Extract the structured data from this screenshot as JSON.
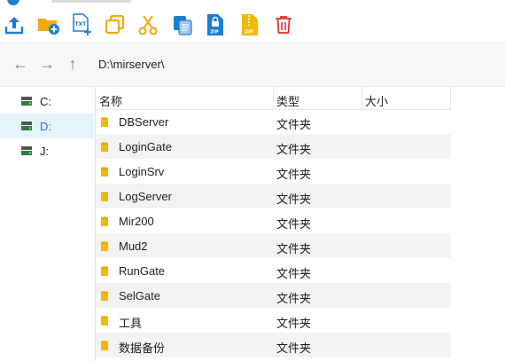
{
  "toolbar": {
    "buttons": [
      {
        "name": "upload-icon",
        "color": "#1a7fd0"
      },
      {
        "name": "new-folder-icon",
        "color": "#f2a90b"
      },
      {
        "name": "new-text-file-icon",
        "color": "#1a7fd0"
      },
      {
        "name": "copy-icon",
        "color": "#f2a90b"
      },
      {
        "name": "cut-icon",
        "color": "#f2a90b"
      },
      {
        "name": "paste-icon",
        "color": "#1a7fd0"
      },
      {
        "name": "compress-zip-icon",
        "color": "#1a7fd0"
      },
      {
        "name": "extract-zip-icon",
        "color": "#f2a90b"
      },
      {
        "name": "delete-icon",
        "color": "#e0322d"
      }
    ]
  },
  "nav": {
    "back_symbol": "←",
    "forward_symbol": "→",
    "up_symbol": "↑",
    "path": "D:\\mirserver\\"
  },
  "sidebar": {
    "drives": [
      {
        "label": "C:",
        "selected": false
      },
      {
        "label": "D:",
        "selected": true
      },
      {
        "label": "J:",
        "selected": false
      }
    ]
  },
  "table": {
    "headers": {
      "name": "名称",
      "type": "类型",
      "size": "大小"
    },
    "rows": [
      {
        "name": "DBServer",
        "type": "文件夹",
        "size": ""
      },
      {
        "name": "LoginGate",
        "type": "文件夹",
        "size": ""
      },
      {
        "name": "LoginSrv",
        "type": "文件夹",
        "size": ""
      },
      {
        "name": "LogServer",
        "type": "文件夹",
        "size": ""
      },
      {
        "name": "Mir200",
        "type": "文件夹",
        "size": ""
      },
      {
        "name": "Mud2",
        "type": "文件夹",
        "size": ""
      },
      {
        "name": "RunGate",
        "type": "文件夹",
        "size": ""
      },
      {
        "name": "SelGate",
        "type": "文件夹",
        "size": ""
      },
      {
        "name": "工具",
        "type": "文件夹",
        "size": ""
      },
      {
        "name": "数据备份",
        "type": "文件夹",
        "size": ""
      }
    ]
  },
  "colors": {
    "accent_blue": "#1a7fd0",
    "folder_yellow": "#f2b90c",
    "delete_red": "#e0322d",
    "selected_bg": "#e5f3fb"
  }
}
